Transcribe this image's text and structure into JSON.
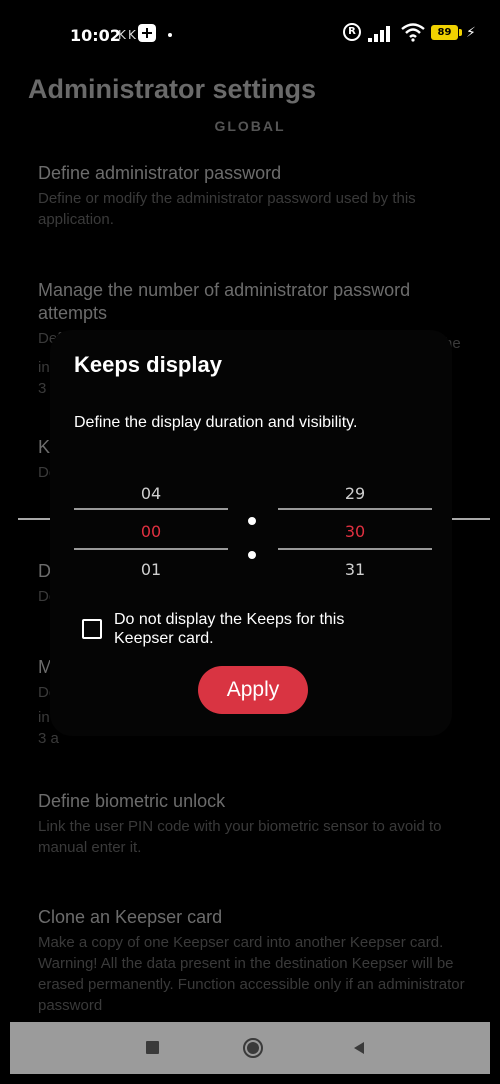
{
  "status_bar": {
    "time": "10:02",
    "k1": "K",
    "k2": "K",
    "registered_symbol": "R",
    "battery": "89",
    "icons": [
      "app-icon",
      "registered-icon",
      "signal-icon",
      "wifi-icon",
      "battery-icon",
      "charging-bolt-icon"
    ]
  },
  "page": {
    "title": "Administrator settings",
    "section_header": "GLOBAL"
  },
  "settings": [
    {
      "title": "Define administrator password",
      "description": "Define or modify the administrator password used by this application."
    },
    {
      "title": "Manage the number of administrator password attempts",
      "description": "Def"
    },
    {
      "title": "K",
      "description": "De"
    },
    {
      "title": "D",
      "description": "De"
    },
    {
      "title": "M",
      "description": "De"
    },
    {
      "title": "Define biometric unlock",
      "description": "Link the user PIN code with your biometric sensor to avoid to manual enter it."
    },
    {
      "title": "Clone an Keepser card",
      "description": "Make a copy of one Keepser card into another Keepser card. Warning! All the data present in the destination Keepser will be erased permanently. Function accessible only if an administrator password"
    }
  ],
  "partial_fragments": {
    "s2_line2_left": "in",
    "s2_line3_left": "3",
    "s2_right": "he",
    "s5_line2_left": "in",
    "s5_line3_left": "3 a"
  },
  "dialog": {
    "title": "Keeps display",
    "text": "Define the display duration and visibility.",
    "hours": {
      "above": "04",
      "selected": "00",
      "below": "01"
    },
    "minutes": {
      "above": "29",
      "selected": "30",
      "below": "31"
    },
    "checkbox_label": "Do not display the Keeps for this Keepser card.",
    "checkbox_checked": false,
    "apply_label": "Apply"
  },
  "nav_bar": {
    "buttons": [
      "recents-button",
      "home-button",
      "back-button"
    ]
  },
  "colors": {
    "accent": "#d93442",
    "picker_selected": "#e03040",
    "background": "#000000",
    "nav_bar": "#9b9b9b"
  }
}
